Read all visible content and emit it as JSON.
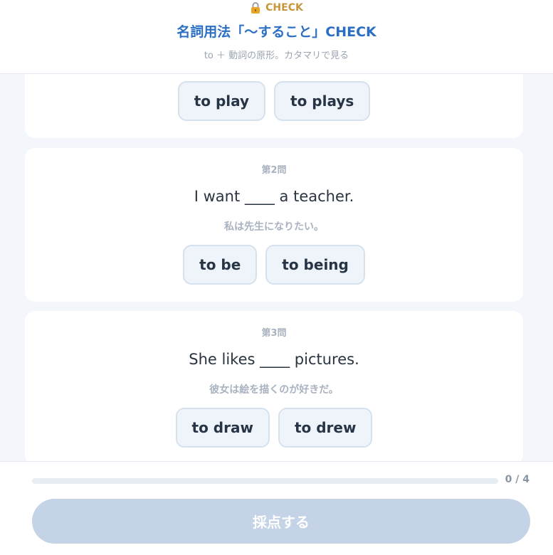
{
  "header": {
    "badge": "CHECK",
    "title": "名詞用法「〜すること」CHECK",
    "subtitle": "to ＋ 動詞の原形。カタマリで見る"
  },
  "questions": [
    {
      "options": [
        "to play",
        "to plays"
      ]
    },
    {
      "number": "第2問",
      "sentence": "I want ____ a teacher.",
      "translation": "私は先生になりたい。",
      "options": [
        "to be",
        "to being"
      ]
    },
    {
      "number": "第3問",
      "sentence": "She likes ____ pictures.",
      "translation": "彼女は絵を描くのが好きだ。",
      "options": [
        "to draw",
        "to drew"
      ]
    }
  ],
  "footer": {
    "progress": {
      "answered": 0,
      "total": 4,
      "text": "0 / 4"
    },
    "submit_label": "採点する"
  },
  "colors": {
    "accent": "#2a6fc4",
    "badge": "#c9953a",
    "disabled_button": "#c5d3e7"
  },
  "icons": {
    "badge": "lock-icon"
  }
}
